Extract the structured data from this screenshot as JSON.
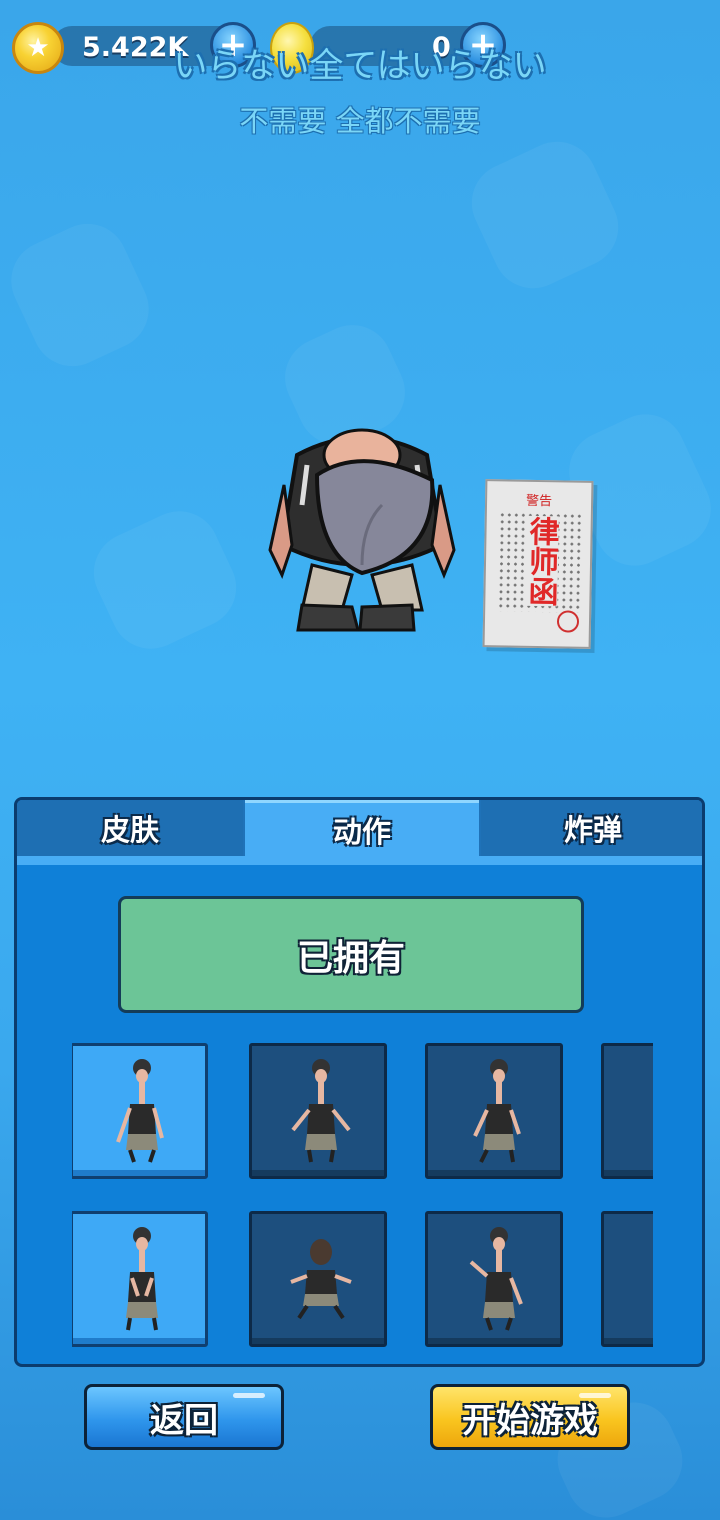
{
  "currency": {
    "coins": {
      "amount": "5.422K",
      "icon": "gold-star-coin-icon"
    },
    "gems": {
      "amount": "0",
      "icon": "yellow-gem-icon"
    }
  },
  "subtitles": {
    "japanese": "いらない全てはいらない",
    "chinese": "不需要 全都不需要"
  },
  "scene": {
    "letter_warning": "警告",
    "letter_title": "律师函"
  },
  "tabs": [
    "皮肤",
    "动作",
    "炸弹"
  ],
  "active_tab": "动作",
  "status_button": "已拥有",
  "buttons": {
    "back": "返回",
    "start": "开始游戏"
  },
  "colors": {
    "owned": "#6cc597",
    "start_button": "#f9c51f",
    "back_button": "#2f96ec",
    "selected_cell": "#3ea9f6"
  }
}
